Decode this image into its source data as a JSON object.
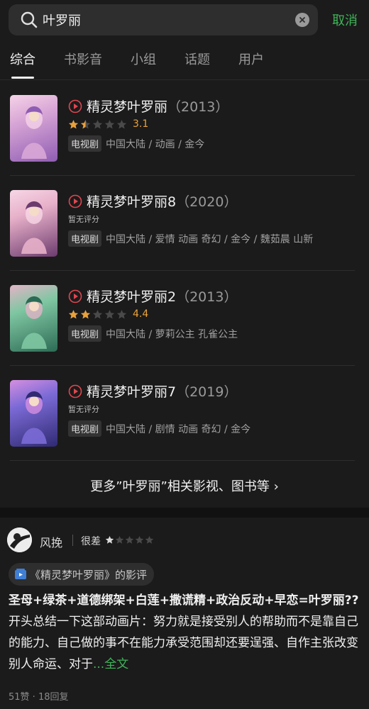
{
  "search": {
    "query": "叶罗丽",
    "cancel_label": "取消"
  },
  "tabs": [
    {
      "label": "综合",
      "active": true
    },
    {
      "label": "书影音",
      "active": false
    },
    {
      "label": "小组",
      "active": false
    },
    {
      "label": "话题",
      "active": false
    },
    {
      "label": "用户",
      "active": false
    }
  ],
  "results": [
    {
      "title": "精灵梦叶罗丽",
      "year": "（2013）",
      "stars_filled": 1.5,
      "score": "3.1",
      "no_score": "",
      "badge": "电视剧",
      "meta": "中国大陆 / 动画 / 金今",
      "poster_colors": [
        "#d9a7d6",
        "#8f5db3",
        "#f5d3e8"
      ]
    },
    {
      "title": "精灵梦叶罗丽8",
      "year": "（2020）",
      "stars_filled": 0,
      "score": "",
      "no_score": "暂无评分",
      "badge": "电视剧",
      "meta": "中国大陆 / 爱情 动画 奇幻 / 金今 / 魏茹晨 山新",
      "poster_colors": [
        "#e7b0c9",
        "#6c3b6e",
        "#f7d7e6"
      ]
    },
    {
      "title": "精灵梦叶罗丽2",
      "year": "（2013）",
      "stars_filled": 2,
      "score": "4.4",
      "no_score": "",
      "badge": "电视剧",
      "meta": "中国大陆 / 萝莉公主 孔雀公主",
      "poster_colors": [
        "#7fc6a2",
        "#2c6b55",
        "#e4b4c7"
      ]
    },
    {
      "title": "精灵梦叶罗丽7",
      "year": "（2019）",
      "stars_filled": 0,
      "score": "",
      "no_score": "暂无评分",
      "badge": "电视剧",
      "meta": "中国大陆 / 剧情 动画 奇幻 / 金今",
      "poster_colors": [
        "#7b6ad6",
        "#2f2a72",
        "#d58fe0"
      ]
    }
  ],
  "more_link": "更多”叶罗丽”相关影视、图书等 ›",
  "review": {
    "reviewer": "风挽",
    "rating_label": "很差",
    "stars_filled": 1,
    "chip_text": "《精灵梦叶罗丽》的影评",
    "headline": "圣母+绿茶+道德绑架+白莲+撒谎精+政治反动+早恋=叶罗丽??",
    "body": "  开头总结一下这部动画片：努力就是接受别人的帮助而不是靠自己的能力、自己做的事不在能力承受范围却还要逞强、自作主张改变别人命运、对于",
    "read_more": "...全文",
    "stats": "51赞 · 18回复"
  },
  "colors": {
    "accent_green": "#3fb559",
    "star_orange": "#e9a23b",
    "play_red": "#e0464f"
  }
}
